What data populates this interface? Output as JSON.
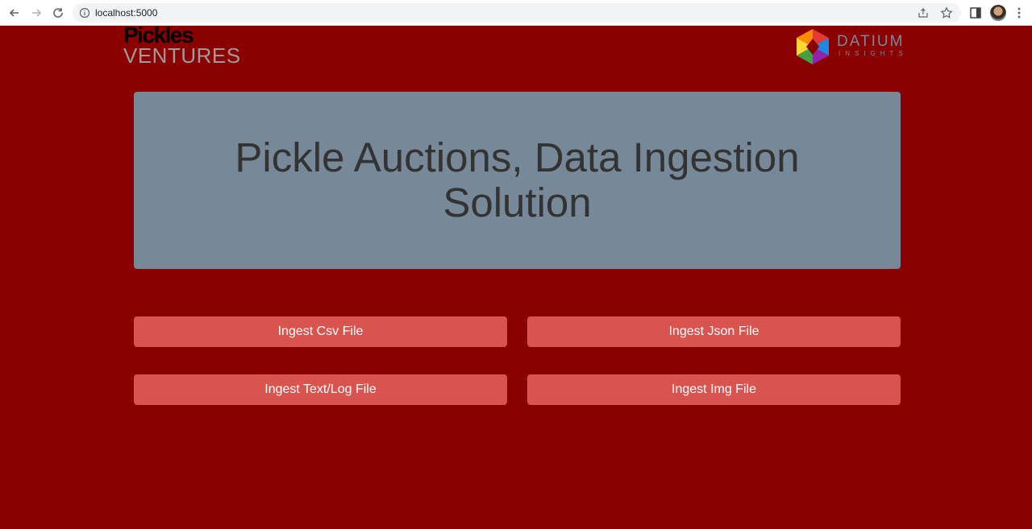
{
  "browser": {
    "url": "localhost:5000",
    "icons": [
      "back-arrow-icon",
      "forward-arrow-icon",
      "reload-icon",
      "site-info-icon",
      "share-icon",
      "bookmark-star-icon",
      "side-panel-icon",
      "profile-avatar",
      "more-menu-icon"
    ]
  },
  "logos": {
    "left": {
      "line1": "Pickles",
      "line2": "VENTURES"
    },
    "right": {
      "line1": "DATIUM",
      "line2": "INSIGHTS"
    }
  },
  "hero": {
    "title": "Pickle Auctions, Data Ingestion Solution"
  },
  "buttons": {
    "csv": "Ingest Csv File",
    "json": "Ingest Json File",
    "text": "Ingest Text/Log File",
    "img": "Ingest Img File"
  },
  "colors": {
    "page_background": "#8b0000",
    "hero_background": "#778899",
    "hero_text": "#333333",
    "button_background": "#d9534f",
    "button_text": "#ffffff"
  }
}
